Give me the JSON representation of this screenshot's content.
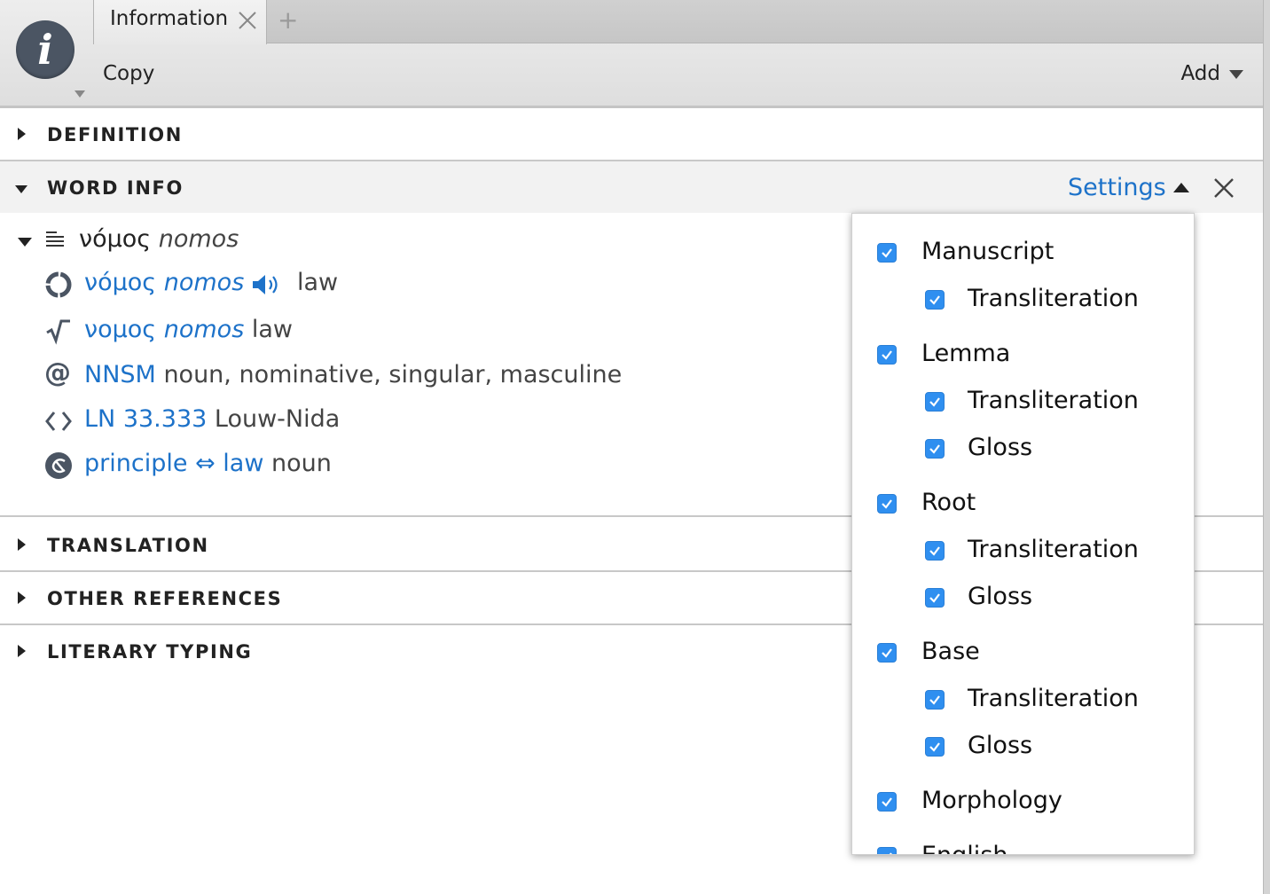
{
  "header": {
    "tab_label": "Information",
    "tab_add": "+",
    "copy_label": "Copy",
    "add_label": "Add"
  },
  "sections": {
    "definition": "DEFINITION",
    "word_info": "WORD INFO",
    "translation": "TRANSLATION",
    "other_references": "OTHER REFERENCES",
    "literary_typing": "LITERARY TYPING"
  },
  "word_info": {
    "settings_label": "Settings",
    "headword": {
      "greek": "νόμος",
      "translit": "nomos"
    },
    "lemma": {
      "greek": "νόμος",
      "translit": "nomos",
      "gloss": "law"
    },
    "root": {
      "greek": "νομος",
      "translit": "nomos",
      "gloss": "law"
    },
    "morphology": {
      "code": "NNSM",
      "desc": "noun, nominative, singular, masculine"
    },
    "louw_nida": {
      "ref": "LN 33.333",
      "label": "Louw-Nida"
    },
    "sense": {
      "from": "principle",
      "arrow": "⇔",
      "to": "law",
      "pos": "noun"
    }
  },
  "settings_options": [
    {
      "label": "Manuscript",
      "checked": true
    },
    {
      "label": "Transliteration",
      "checked": true
    },
    {
      "label": "Lemma",
      "checked": true
    },
    {
      "label": "Transliteration",
      "checked": true
    },
    {
      "label": "Gloss",
      "checked": true
    },
    {
      "label": "Root",
      "checked": true
    },
    {
      "label": "Transliteration",
      "checked": true
    },
    {
      "label": "Gloss",
      "checked": true
    },
    {
      "label": "Base",
      "checked": true
    },
    {
      "label": "Transliteration",
      "checked": true
    },
    {
      "label": "Gloss",
      "checked": true
    },
    {
      "label": "Morphology",
      "checked": true
    },
    {
      "label": "English",
      "checked": true
    }
  ],
  "colors": {
    "link": "#1d72c9",
    "checkbox": "#2f8ff0",
    "icon": "#4b5563"
  }
}
